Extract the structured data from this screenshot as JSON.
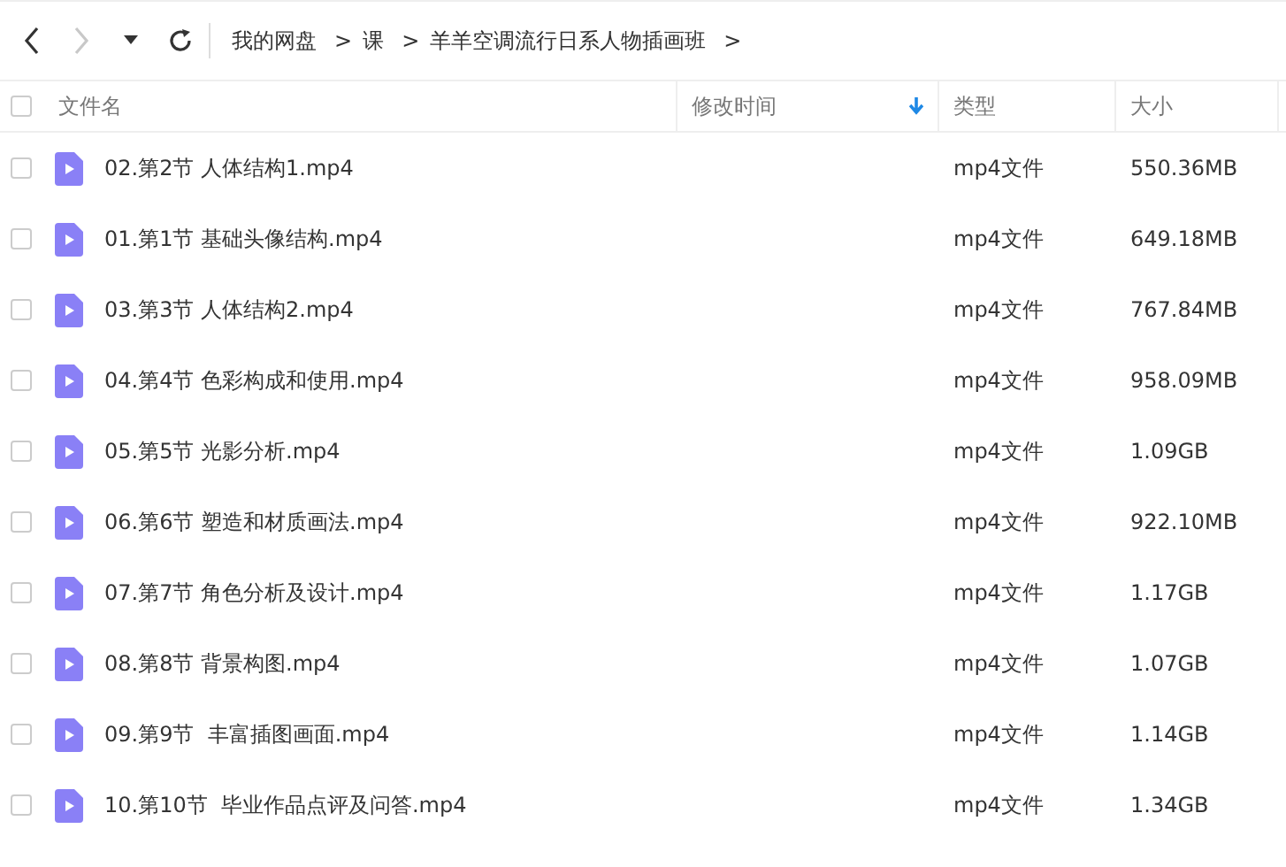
{
  "toolbar": {
    "nav_buttons": [
      {
        "kind": "back",
        "disabled": false
      },
      {
        "kind": "forward",
        "disabled": true
      },
      {
        "kind": "dropdown",
        "disabled": false
      },
      {
        "kind": "refresh",
        "disabled": false
      }
    ],
    "breadcrumbs": [
      {
        "label": "我的网盘",
        "separator": ">"
      },
      {
        "label": "课",
        "separator": ">"
      },
      {
        "label": "羊羊空调流行日系人物插画班",
        "separator": ">"
      }
    ]
  },
  "table": {
    "select_all": {
      "checked": false
    },
    "columns": [
      {
        "label": "文件名",
        "sorted": false
      },
      {
        "label": "修改时间",
        "sorted": true
      },
      {
        "label": "类型",
        "sorted": false
      },
      {
        "label": "大小",
        "sorted": false
      }
    ],
    "rows": [
      {
        "name": "02.第2节 人体结构1.mp4",
        "type": "mp4文件",
        "size": "550.36MB",
        "checked": false
      },
      {
        "name": "01.第1节 基础头像结构.mp4",
        "type": "mp4文件",
        "size": "649.18MB",
        "checked": false
      },
      {
        "name": "03.第3节 人体结构2.mp4",
        "type": "mp4文件",
        "size": "767.84MB",
        "checked": false
      },
      {
        "name": "04.第4节 色彩构成和使用.mp4",
        "type": "mp4文件",
        "size": "958.09MB",
        "checked": false
      },
      {
        "name": "05.第5节 光影分析.mp4",
        "type": "mp4文件",
        "size": "1.09GB",
        "checked": false
      },
      {
        "name": "06.第6节 塑造和材质画法.mp4",
        "type": "mp4文件",
        "size": "922.10MB",
        "checked": false
      },
      {
        "name": "07.第7节 角色分析及设计.mp4",
        "type": "mp4文件",
        "size": "1.17GB",
        "checked": false
      },
      {
        "name": "08.第8节 背景构图.mp4",
        "type": "mp4文件",
        "size": "1.07GB",
        "checked": false
      },
      {
        "name": "09.第9节  丰富插图画面.mp4",
        "type": "mp4文件",
        "size": "1.14GB",
        "checked": false
      },
      {
        "name": "10.第10节  毕业作品点评及问答.mp4",
        "type": "mp4文件",
        "size": "1.34GB",
        "checked": false
      }
    ]
  }
}
